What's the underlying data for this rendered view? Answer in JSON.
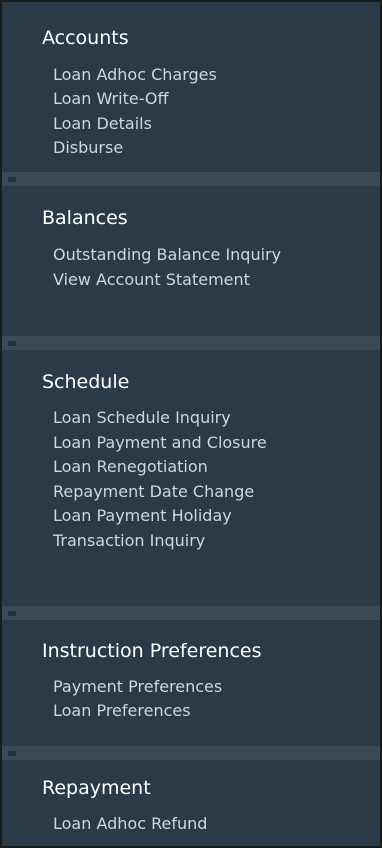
{
  "sections": [
    {
      "title": "Accounts",
      "items": [
        "Loan Adhoc Charges",
        "Loan Write-Off",
        "Loan Details",
        "Disburse"
      ]
    },
    {
      "title": "Balances",
      "items": [
        "Outstanding Balance Inquiry",
        "View Account Statement"
      ]
    },
    {
      "title": "Schedule",
      "items": [
        "Loan Schedule Inquiry",
        "Loan Payment and Closure",
        "Loan Renegotiation",
        "Repayment Date Change",
        "Loan Payment Holiday",
        "Transaction Inquiry"
      ]
    },
    {
      "title": "Instruction Preferences",
      "items": [
        "Payment Preferences",
        "Loan Preferences"
      ]
    },
    {
      "title": "Repayment",
      "items": [
        "Loan Adhoc Refund"
      ]
    }
  ]
}
